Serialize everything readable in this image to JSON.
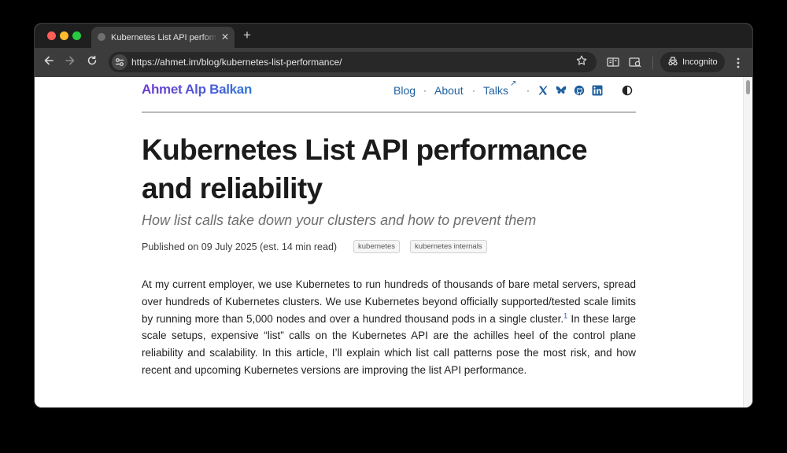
{
  "browser": {
    "tab_title": "Kubernetes List API performance and reliability",
    "tab_close": "✕",
    "new_tab": "+",
    "url": "https://ahmet.im/blog/kubernetes-list-performance/",
    "incognito_label": "Incognito",
    "traffic_lights": [
      "#ff5f57",
      "#febc2e",
      "#28c840"
    ]
  },
  "site": {
    "name": "Ahmet Alp Balkan",
    "nav": [
      {
        "label": "Blog"
      },
      {
        "label": "About"
      },
      {
        "label": "Talks"
      }
    ],
    "nav_separator": "·",
    "external_arrow": "↗",
    "social_icons": [
      "x-icon",
      "bluesky-icon",
      "github-icon",
      "linkedin-icon"
    ],
    "theme_toggle_icon": "contrast-icon"
  },
  "post": {
    "title": "Kubernetes List API performance and reliability",
    "subtitle": "How list calls take down your clusters and how to prevent them",
    "meta": "Published on 09 July 2025 (est. 14 min read)",
    "tags": [
      "kubernetes",
      "kubernetes internals"
    ],
    "body_before_footnote": "At my current employer, we use Kubernetes to run hundreds of thousands of bare metal servers, spread over hundreds of Kubernetes clusters. We use Kubernetes beyond officially supported/tested scale limits by running more than 5,000 nodes and over a hundred thousand pods in a single cluster.",
    "footnote_ref": "1",
    "body_after_footnote": " In these large scale setups, expensive “list” calls on the Kubernetes API are the achilles heel of the control plane reliability and scalability. In this article, I’ll explain which list call patterns pose the most risk, and how recent and upcoming Kubernetes versions are improving the list API performance."
  },
  "colors": {
    "link": "#1f5f9e",
    "title": "#1b1b1b",
    "brand_gradient_start": "#6d3bd0",
    "brand_gradient_end": "#2f77d8"
  }
}
